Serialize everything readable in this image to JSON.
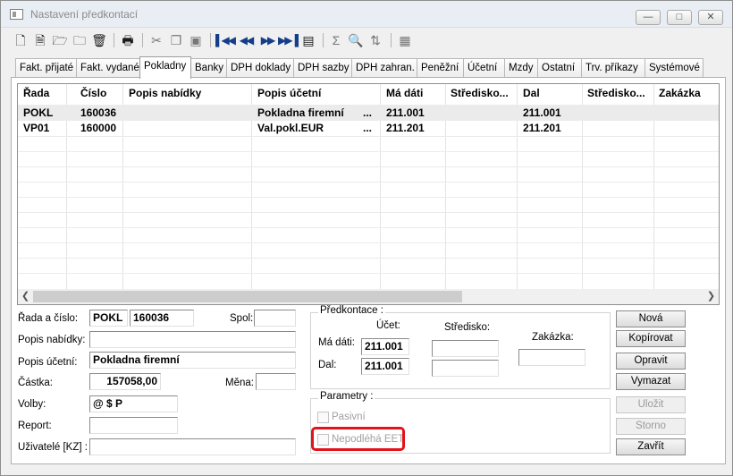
{
  "window": {
    "title": "Nastavení předkontací",
    "controls": {
      "minimize": "—",
      "maximize": "□",
      "close": "✕"
    }
  },
  "toolbar": {
    "icons": [
      "new-icon",
      "document-icon",
      "open-folder-icon",
      "folder-save-icon",
      "delete-icon",
      "print-icon",
      "cut-icon",
      "copy-icon",
      "paste-icon",
      "first-record-icon",
      "previous-record-icon",
      "next-record-icon",
      "last-record-icon",
      "view-icon",
      "sum-icon",
      "search-icon",
      "sort-icon",
      "grid-icon"
    ]
  },
  "tabs": [
    "Fakt. přijaté",
    "Fakt. vydané",
    "Pokladny",
    "Banky",
    "DPH doklady",
    "DPH sazby",
    "DPH zahran.",
    "Peněžní",
    "Účetní",
    "Mzdy",
    "Ostatní",
    "Trv. příkazy",
    "Systémové"
  ],
  "active_tab": "Pokladny",
  "grid": {
    "columns": [
      "Řada",
      "Číslo",
      "Popis nabídky",
      "Popis účetní",
      "Má dáti",
      "Středisko...",
      "Dal",
      "Středisko...",
      "Zakázka"
    ],
    "rows": [
      [
        "POKL",
        "160036",
        "",
        "Pokladna firemní",
        "211.001",
        "",
        "211.001",
        "",
        ""
      ],
      [
        "VP01",
        "160000",
        "",
        "Val.pokl.EUR",
        "211.201",
        "",
        "211.201",
        "",
        ""
      ]
    ],
    "ellipsis": "..."
  },
  "form": {
    "rada_label": "Řada a číslo:",
    "rada_value": "POKL",
    "cislo_value": "160036",
    "spol_label": "Spol:",
    "spol_value": "",
    "popis_nabidky_label": "Popis nabídky:",
    "popis_nabidky_value": "",
    "popis_ucetni_label": "Popis účetní:",
    "popis_ucetni_value": "Pokladna firemní",
    "castka_label": "Částka:",
    "castka_value": "157058,00",
    "mena_label": "Měna:",
    "mena_value": "",
    "volby_label": "Volby:",
    "volby_value": "@ $ P",
    "report_label": "Report:",
    "report_value": "",
    "uzivatele_label": "Uživatelé [KZ] :",
    "uzivatele_value": ""
  },
  "predkontace": {
    "legend": "Předkontace :",
    "ucet_label": "Účet:",
    "stredisko_label": "Středisko:",
    "zakazka_label": "Zakázka:",
    "ma_dati_label": "Má dáti:",
    "ma_dati_value": "211.001",
    "dal_label": "Dal:",
    "dal_value": "211.001"
  },
  "parametry": {
    "legend": "Parametry :",
    "pasivni_label": "Pasivní",
    "nepodleha_label": "Nepodléhá EET"
  },
  "buttons": {
    "nova": "Nová",
    "kopirovat": "Kopírovat",
    "opravit": "Opravit",
    "vymazat": "Vymazat",
    "ulozit": "Uložit",
    "storno": "Storno",
    "zavrit": "Zavřít"
  },
  "colors": {
    "highlight": "#e0141b",
    "selected_row": "#ebebeb"
  }
}
